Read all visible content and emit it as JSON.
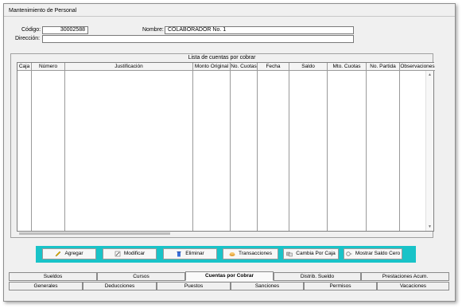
{
  "window": {
    "title": "Mantenimiento de Personal"
  },
  "form": {
    "codigo_label": "Código:",
    "codigo_value": "30002588",
    "nombre_label": "Nombre:",
    "nombre_value": "COLABORADOR No. 1",
    "direccion_label": "Dirección:",
    "direccion_value": ""
  },
  "group": {
    "title": "Lista de cuentas por cobrar"
  },
  "grid": {
    "columns": [
      "Caja",
      "Número",
      "Justificación",
      "Monto Original",
      "No. Cuotas",
      "Fecha",
      "Saldo",
      "Mto. Cuotas",
      "No. Partida",
      "Observaciones"
    ],
    "rows": []
  },
  "buttons": {
    "agregar": "Agregar",
    "modificar": "Modificar",
    "eliminar": "Eliminar",
    "transacciones": "Transacciones",
    "cambia_por_caja": "Cambia Por Caja",
    "mostrar_saldo_cero": "Mostrar Saldo Cero"
  },
  "tabs_row1": [
    "Sueldos",
    "Cursos",
    "Cuentas por Cobrar",
    "Distrib. Sueldo",
    "Prestaciones Acum."
  ],
  "tabs_row2": [
    "Generales",
    "Deducciones",
    "Puestos",
    "Sanciones",
    "Permisos",
    "Vacaciones"
  ],
  "active_tab": "Cuentas por Cobrar",
  "colors": {
    "button_bar": "#19c3c8",
    "window_bg": "#f0f0f0"
  }
}
